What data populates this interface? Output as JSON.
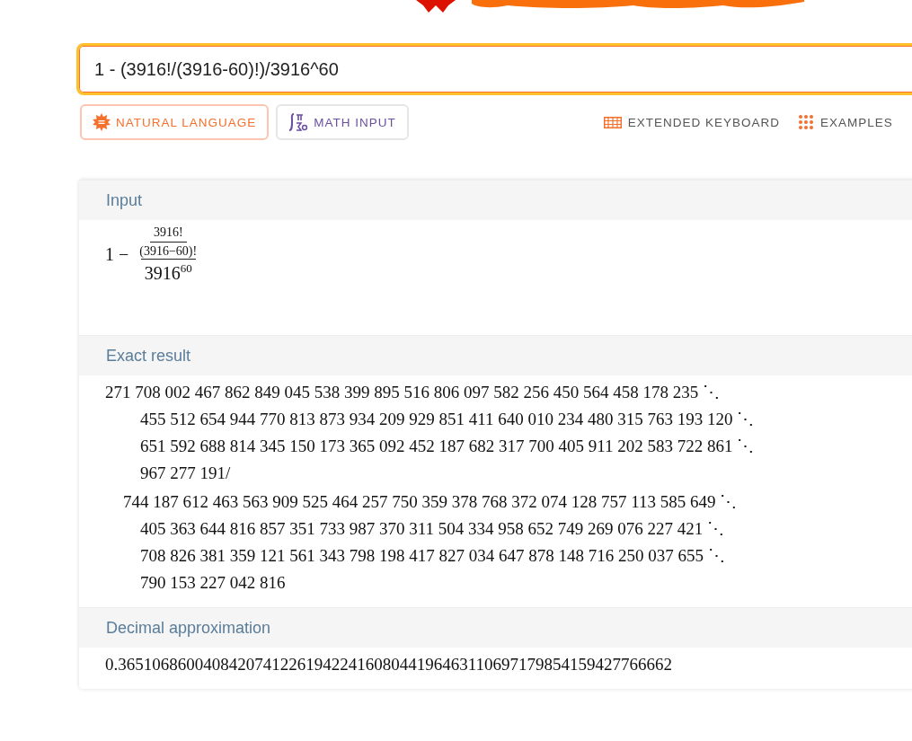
{
  "search": {
    "value": "1 - (3916!/(3916-60)!)/3916^60"
  },
  "modes": [
    {
      "label": "NATURAL LANGUAGE",
      "selected": true,
      "kind": "natural"
    },
    {
      "label": "MATH INPUT",
      "selected": false,
      "kind": "math"
    }
  ],
  "tools": [
    {
      "label": "EXTENDED KEYBOARD",
      "kind": "keyboard"
    },
    {
      "label": "EXAMPLES",
      "kind": "examples"
    }
  ],
  "pods": [
    {
      "title": "Input",
      "kind": "formula",
      "formula": {
        "lead": "1 −",
        "inner_numerator": "3916!",
        "inner_denominator": "(3916−60)!",
        "base": "3916",
        "exponent": "60"
      }
    },
    {
      "title": "Exact result",
      "kind": "lines",
      "lines": [
        {
          "text": "271 708 002 467 862 849 045 538 399 895 516 806 097 582 256 450 564 458 178 235 ⋱",
          "kind": "numerator"
        },
        {
          "text": "455 512 654 944 770 813 873 934 209 929 851 411 640 010 234 480 315 763 193 120 ⋱",
          "kind": "continuation"
        },
        {
          "text": "651 592 688 814 345 150 173 365 092 452 187 682 317 700 405 911 202 583 722 861 ⋱",
          "kind": "continuation"
        },
        {
          "text": "967 277 191/",
          "kind": "continuation"
        },
        {
          "text": "744 187 612 463 563 909 525 464 257 750 359 378 768 372 074 128 757 113 585 649 ⋱",
          "kind": "denominator"
        },
        {
          "text": "405 363 644 816 857 351 733 987 370 311 504 334 958 652 749 269 076 227 421 ⋱",
          "kind": "continuation"
        },
        {
          "text": "708 826 381 359 121 561 343 798 198 417 827 034 647 878 148 716 250 037 655 ⋱",
          "kind": "continuation"
        },
        {
          "text": "790 153 227 042 816",
          "kind": "continuation"
        }
      ]
    },
    {
      "title": "Decimal approximation",
      "kind": "lines",
      "lines": [
        {
          "text": "0.36510686004084207412261942241608044196463110697179854159427766662",
          "kind": "numerator"
        }
      ]
    }
  ]
}
